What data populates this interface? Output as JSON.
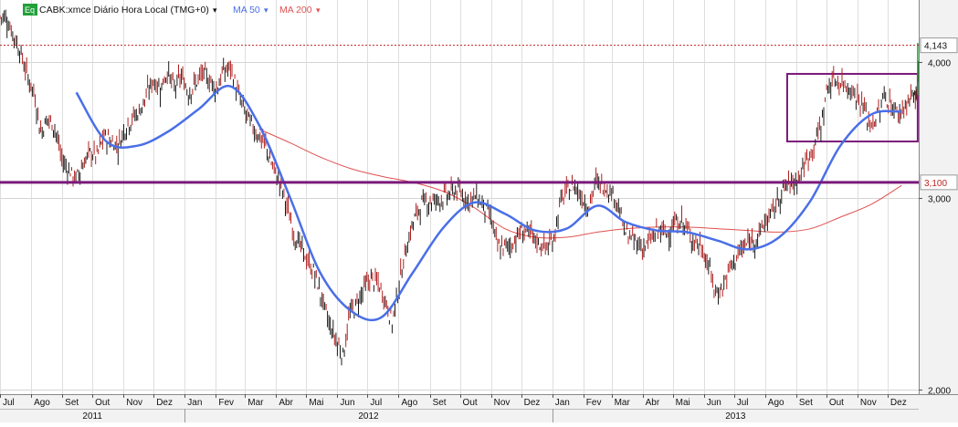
{
  "chart_data": {
    "type": "line",
    "symbol": "CABK:xmce",
    "legend": {
      "title": "CABK:xmce Diário Hora Local (TMG+0)",
      "ma50_label": "MA 50",
      "ma200_label": "MA 200",
      "eq_badge": "Eq"
    },
    "colors": {
      "price": "#1a1a1a",
      "bar_down": "#b02020",
      "ma50": "#4a6fe8",
      "ma200": "#e05050",
      "resistance_line": "#7a1a7a",
      "last_price_line": "#c02020",
      "box": "#7a1a7a",
      "axis_bg": "#f2f2f2"
    },
    "y_axis": {
      "scale": "log",
      "range": [
        1980,
        4560
      ],
      "ticks": [
        2000,
        3000,
        4000
      ],
      "tick_labels": [
        "2,000",
        "3,000",
        "4,000"
      ],
      "grid": true,
      "position": "right"
    },
    "x_axis": {
      "start": "2011-07",
      "end": "2014-01",
      "month_labels": [
        "Jul",
        "Ago",
        "Set",
        "Out",
        "Nov",
        "Dez",
        "Jan",
        "Fev",
        "Mar",
        "Abr",
        "Mai",
        "Jun",
        "Jul",
        "Ago",
        "Set",
        "Out",
        "Nov",
        "Dez",
        "Jan",
        "Fev",
        "Mar",
        "Abr",
        "Mai",
        "Jun",
        "Jul",
        "Ago",
        "Set",
        "Out",
        "Nov",
        "Dez"
      ],
      "year_labels": [
        {
          "label": "2011",
          "start_index": 0
        },
        {
          "label": "2012",
          "start_index": 6
        },
        {
          "label": "2013",
          "start_index": 18
        }
      ]
    },
    "reference_lines": [
      {
        "kind": "horizontal",
        "value": 3100,
        "label": "3,100"
      },
      {
        "kind": "last_price",
        "value": 4143,
        "label": "4,143"
      }
    ],
    "annotations": [
      {
        "kind": "box",
        "x_start": "2013-08-23",
        "x_end": "2013-12-31",
        "y_low": 3380,
        "y_high": 3900
      }
    ],
    "series": [
      {
        "name": "CABK:xmce",
        "style": "ohlc",
        "x": [
          "2011-07-01",
          "2011-07-08",
          "2011-07-15",
          "2011-07-22",
          "2011-07-29",
          "2011-08-05",
          "2011-08-12",
          "2011-08-19",
          "2011-08-26",
          "2011-09-02",
          "2011-09-09",
          "2011-09-16",
          "2011-09-23",
          "2011-09-30",
          "2011-10-07",
          "2011-10-14",
          "2011-10-21",
          "2011-10-28",
          "2011-11-04",
          "2011-11-11",
          "2011-11-18",
          "2011-11-25",
          "2011-12-02",
          "2011-12-09",
          "2011-12-16",
          "2011-12-23",
          "2011-12-30",
          "2012-01-06",
          "2012-01-13",
          "2012-01-20",
          "2012-01-27",
          "2012-02-03",
          "2012-02-10",
          "2012-02-17",
          "2012-02-24",
          "2012-03-02",
          "2012-03-09",
          "2012-03-16",
          "2012-03-23",
          "2012-03-30",
          "2012-04-06",
          "2012-04-13",
          "2012-04-20",
          "2012-04-27",
          "2012-05-04",
          "2012-05-11",
          "2012-05-18",
          "2012-05-25",
          "2012-06-01",
          "2012-06-08",
          "2012-06-15",
          "2012-06-22",
          "2012-06-29",
          "2012-07-06",
          "2012-07-13",
          "2012-07-20",
          "2012-07-27",
          "2012-08-03",
          "2012-08-10",
          "2012-08-17",
          "2012-08-24",
          "2012-08-31",
          "2012-09-07",
          "2012-09-14",
          "2012-09-21",
          "2012-09-28",
          "2012-10-05",
          "2012-10-12",
          "2012-10-19",
          "2012-10-26",
          "2012-11-02",
          "2012-11-09",
          "2012-11-16",
          "2012-11-23",
          "2012-11-30",
          "2012-12-07",
          "2012-12-14",
          "2012-12-21",
          "2012-12-28",
          "2013-01-04",
          "2013-01-11",
          "2013-01-18",
          "2013-01-25",
          "2013-02-01",
          "2013-02-08",
          "2013-02-15",
          "2013-02-22",
          "2013-03-01",
          "2013-03-08",
          "2013-03-15",
          "2013-03-22",
          "2013-03-29",
          "2013-04-05",
          "2013-04-12",
          "2013-04-19",
          "2013-04-26",
          "2013-05-03",
          "2013-05-10",
          "2013-05-17",
          "2013-05-24",
          "2013-05-31",
          "2013-06-07",
          "2013-06-14",
          "2013-06-21",
          "2013-06-28",
          "2013-07-05",
          "2013-07-12",
          "2013-07-19",
          "2013-07-26",
          "2013-08-02",
          "2013-08-09",
          "2013-08-16",
          "2013-08-23",
          "2013-08-30",
          "2013-09-06",
          "2013-09-13",
          "2013-09-20",
          "2013-09-27",
          "2013-10-04",
          "2013-10-11",
          "2013-10-18",
          "2013-10-25",
          "2013-11-01",
          "2013-11-08",
          "2013-11-15",
          "2013-11-22",
          "2013-11-29",
          "2013-12-06",
          "2013-12-13",
          "2013-12-20",
          "2013-12-27",
          "2013-12-31"
        ],
        "close": [
          4400,
          4250,
          4100,
          3900,
          3750,
          3450,
          3550,
          3480,
          3250,
          3180,
          3120,
          3220,
          3300,
          3280,
          3420,
          3380,
          3350,
          3480,
          3550,
          3600,
          3720,
          3850,
          3780,
          3920,
          3780,
          3880,
          3750,
          3820,
          3900,
          3850,
          3780,
          3920,
          3950,
          3750,
          3600,
          3500,
          3420,
          3350,
          3200,
          3100,
          2950,
          2780,
          2700,
          2620,
          2550,
          2420,
          2300,
          2220,
          2150,
          2350,
          2400,
          2480,
          2530,
          2500,
          2420,
          2300,
          2500,
          2700,
          2850,
          2950,
          2980,
          2980,
          3000,
          3020,
          3050,
          3020,
          2980,
          3010,
          2950,
          2880,
          2700,
          2700,
          2720,
          2780,
          2800,
          2760,
          2720,
          2700,
          2760,
          2980,
          3050,
          3080,
          3000,
          2950,
          3100,
          3080,
          3050,
          2980,
          2800,
          2750,
          2720,
          2700,
          2760,
          2800,
          2780,
          2830,
          2860,
          2800,
          2740,
          2700,
          2600,
          2450,
          2480,
          2580,
          2650,
          2700,
          2740,
          2760,
          2850,
          2900,
          3000,
          3080,
          3100,
          3150,
          3250,
          3350,
          3500,
          3800,
          3850,
          3820,
          3800,
          3720,
          3640,
          3500,
          3560,
          3720,
          3650,
          3580,
          3650,
          3720,
          3730,
          4143
        ]
      },
      {
        "name": "MA 50",
        "x": [
          "2011-09",
          "2011-10",
          "2011-11",
          "2011-12",
          "2012-01",
          "2012-02",
          "2012-03",
          "2012-04",
          "2012-05",
          "2012-06",
          "2012-07",
          "2012-08",
          "2012-09",
          "2012-10",
          "2012-11",
          "2012-12",
          "2013-01",
          "2013-02",
          "2013-03",
          "2013-04",
          "2013-05",
          "2013-06",
          "2013-07",
          "2013-08",
          "2013-09",
          "2013-10",
          "2013-11",
          "2013-12"
        ],
        "values": [
          3750,
          3380,
          3350,
          3450,
          3620,
          3800,
          3500,
          3000,
          2560,
          2360,
          2330,
          2560,
          2820,
          2970,
          2900,
          2800,
          2810,
          2950,
          2850,
          2800,
          2790,
          2740,
          2690,
          2760,
          2980,
          3350,
          3580,
          3600
        ]
      },
      {
        "name": "MA 200",
        "x": [
          "2012-03",
          "2012-04",
          "2012-05",
          "2012-06",
          "2012-07",
          "2012-08",
          "2012-09",
          "2012-10",
          "2012-11",
          "2012-12",
          "2013-01",
          "2013-02",
          "2013-03",
          "2013-04",
          "2013-05",
          "2013-06",
          "2013-07",
          "2013-08",
          "2013-09",
          "2013-10",
          "2013-11",
          "2013-12"
        ],
        "values": [
          3470,
          3370,
          3270,
          3190,
          3140,
          3100,
          3040,
          2940,
          2810,
          2760,
          2760,
          2790,
          2810,
          2820,
          2820,
          2810,
          2800,
          2790,
          2810,
          2880,
          2960,
          3080
        ]
      }
    ]
  }
}
